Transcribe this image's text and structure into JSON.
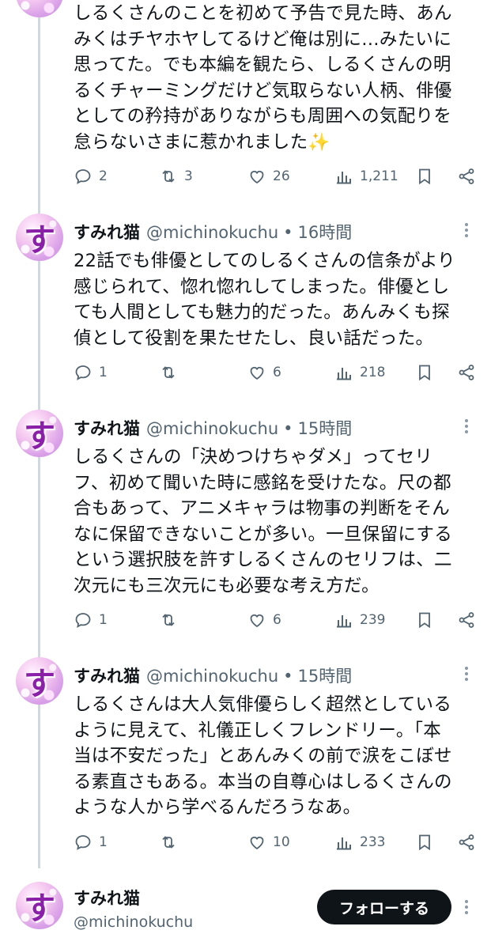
{
  "colors": {
    "text": "#0f1419",
    "muted": "#536471",
    "line": "#cfd9de",
    "follow_bg": "#0f1419"
  },
  "tweets": [
    {
      "text": "しるくさんのことを初めて予告で見た時、あん\nみくはチヤホヤしてるけど俺は別に…みたいに\n思ってた。でも本編を観たら、しるくさんの明\nるくチャーミングだけど気取らない人柄、俳優\nとしての矜持がありながらも周囲への気配りを\n怠らないさまに惹かれました✨",
      "replies": "2",
      "retweets": "3",
      "likes": "26",
      "views": "1,211"
    },
    {
      "avatar_glyph": "す",
      "name": "すみれ猫",
      "handle": "@michinokuchu",
      "dot": "•",
      "time": "16時間",
      "text": "22話でも俳優としてのしるくさんの信条がより\n感じられて、惚れ惚れしてしまった。俳優とし\nても人間としても魅力的だった。あんみくも探\n偵として役割を果たせたし、良い話だった。",
      "replies": "1",
      "retweets": "",
      "likes": "6",
      "views": "218"
    },
    {
      "avatar_glyph": "す",
      "name": "すみれ猫",
      "handle": "@michinokuchu",
      "dot": "•",
      "time": "15時間",
      "text": "しるくさんの「決めつけちゃダメ」ってセリ\nフ、初めて聞いた時に感銘を受けたな。尺の都\n合もあって、アニメキャラは物事の判断をそん\nなに保留できないことが多い。一旦保留にする\nという選択肢を許すしるくさんのセリフは、二\n次元にも三次元にも必要な考え方だ。",
      "replies": "1",
      "retweets": "",
      "likes": "6",
      "views": "239"
    },
    {
      "avatar_glyph": "す",
      "name": "すみれ猫",
      "handle": "@michinokuchu",
      "dot": "•",
      "time": "15時間",
      "text": "しるくさんは大人気俳優らしく超然としている\nように見えて、礼儀正しくフレンドリー。「本\n当は不安だった」とあんみくの前で涙をこぼせ\nる素直さもある。本当の自尊心はしるくさんの\nような人から学べるんだろうなあ。",
      "replies": "1",
      "retweets": "",
      "likes": "10",
      "views": "233"
    }
  ],
  "profile": {
    "avatar_glyph": "す",
    "name": "すみれ猫",
    "handle": "@michinokuchu",
    "follow_label": "フォローする"
  }
}
